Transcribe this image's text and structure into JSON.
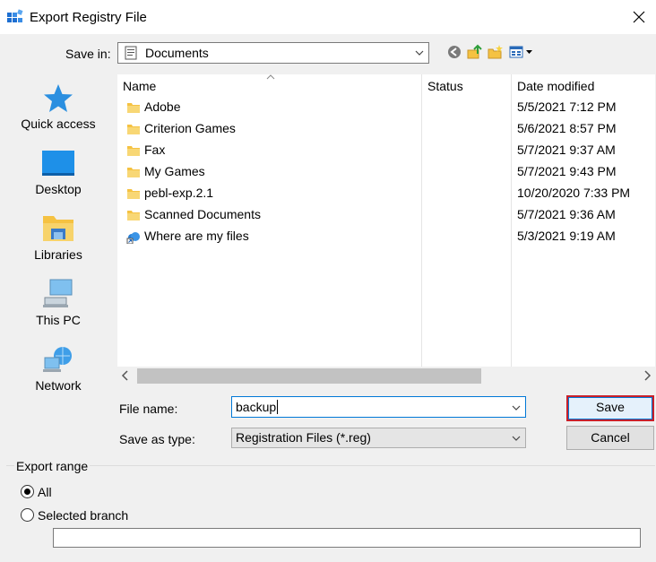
{
  "window": {
    "title": "Export Registry File",
    "close_glyph": "✕"
  },
  "toolbar": {
    "save_in_label": "Save in:",
    "save_in_value": "Documents",
    "back_icon": "back-arrow-icon",
    "up_icon": "up-folder-icon",
    "new_folder_icon": "new-folder-icon",
    "view_icon": "view-menu-icon"
  },
  "places": [
    {
      "label": "Quick access",
      "icon": "star-icon"
    },
    {
      "label": "Desktop",
      "icon": "desktop-icon"
    },
    {
      "label": "Libraries",
      "icon": "libraries-icon"
    },
    {
      "label": "This PC",
      "icon": "computer-icon"
    },
    {
      "label": "Network",
      "icon": "network-icon"
    }
  ],
  "file_list": {
    "columns": {
      "name": "Name",
      "status": "Status",
      "date": "Date modified"
    },
    "rows": [
      {
        "name": "Adobe",
        "date": "5/5/2021 7:12 PM",
        "icon": "folder-icon"
      },
      {
        "name": "Criterion Games",
        "date": "5/6/2021 8:57 PM",
        "icon": "folder-icon"
      },
      {
        "name": "Fax",
        "date": "5/7/2021 9:37 AM",
        "icon": "folder-icon"
      },
      {
        "name": "My Games",
        "date": "5/7/2021 9:43 PM",
        "icon": "folder-icon"
      },
      {
        "name": "pebl-exp.2.1",
        "date": "10/20/2020 7:33 PM",
        "icon": "folder-icon"
      },
      {
        "name": "Scanned Documents",
        "date": "5/7/2021 9:36 AM",
        "icon": "folder-icon"
      },
      {
        "name": "Where are my files",
        "date": "5/3/2021 9:19 AM",
        "icon": "shortcut-cloud-icon"
      }
    ]
  },
  "form": {
    "file_name_label": "File name:",
    "file_name_value": "backup",
    "save_as_type_label": "Save as type:",
    "save_as_type_value": "Registration Files (*.reg)",
    "save_label": "Save",
    "cancel_label": "Cancel"
  },
  "export_range": {
    "title": "Export range",
    "all_label": "All",
    "selected_branch_label": "Selected branch",
    "selected_option": "All",
    "branch_value": ""
  },
  "colors": {
    "accent": "#0078d7",
    "highlight_border": "#c8202a",
    "folder": "#f5c242"
  }
}
